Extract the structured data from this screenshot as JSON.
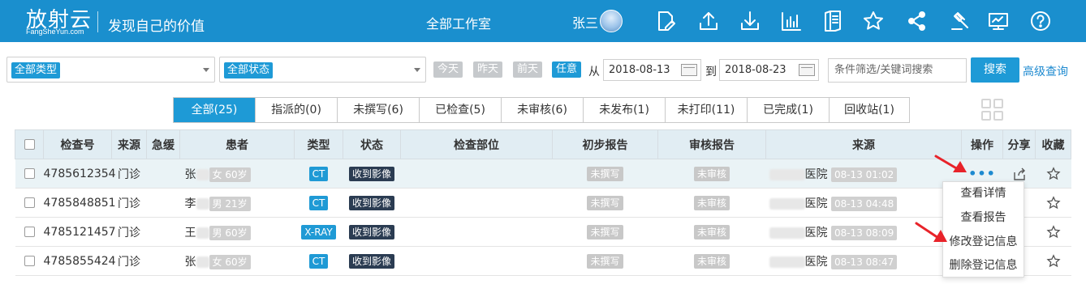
{
  "header": {
    "logo_main": "放射云",
    "logo_sub": "FangSheYun.com",
    "slogan": "发现自己的价值",
    "workspace": "全部工作室",
    "username": "张三"
  },
  "toolbar_icons": [
    "edit-icon",
    "upload-icon",
    "download-icon",
    "bar-chart-icon",
    "document-icon",
    "star-icon",
    "share-icon",
    "gavel-icon",
    "monitor-icon",
    "help-icon"
  ],
  "filters": {
    "type_select": "全部类型",
    "status_select": "全部状态",
    "quick_dates": [
      "今天",
      "昨天",
      "前天",
      "任意"
    ],
    "from_label": "从",
    "from_date": "2018-08-13",
    "to_label": "到",
    "to_date": "2018-08-23",
    "search_placeholder": "条件筛选/关键词搜索",
    "search_button": "搜索",
    "advanced": "高级查询"
  },
  "tabs": [
    {
      "label": "全部(25)"
    },
    {
      "label": "指派的(0)"
    },
    {
      "label": "未撰写(6)"
    },
    {
      "label": "已检查(5)"
    },
    {
      "label": "未审核(6)"
    },
    {
      "label": "未发布(1)"
    },
    {
      "label": "未打印(11)"
    },
    {
      "label": "已完成(1)"
    },
    {
      "label": "回收站(1)"
    }
  ],
  "columns": [
    "检查号",
    "来源",
    "急缓",
    "患者",
    "类型",
    "状态",
    "检查部位",
    "初步报告",
    "审核报告",
    "来源",
    "操作",
    "分享",
    "收藏"
  ],
  "rows": [
    {
      "id": "4785612354",
      "source": "门诊",
      "surname": "张",
      "patient_info": "女 60岁",
      "type": "CT",
      "status": "收到影像",
      "prelim": "未撰写",
      "review": "未审核",
      "hospital": "医院",
      "time": "08-13 01:02"
    },
    {
      "id": "4785848851",
      "source": "门诊",
      "surname": "李",
      "patient_info": "男 21岁",
      "type": "CT",
      "status": "收到影像",
      "prelim": "未撰写",
      "review": "未审核",
      "hospital": "医院",
      "time": "08-13 04:48"
    },
    {
      "id": "4785121457",
      "source": "门诊",
      "surname": "王",
      "patient_info": "男 60岁",
      "type": "X-RAY",
      "status": "收到影像",
      "prelim": "未撰写",
      "review": "未审核",
      "hospital": "医院",
      "time": "08-13 08:09"
    },
    {
      "id": "4785855424",
      "source": "门诊",
      "surname": "张",
      "patient_info": "女 60岁",
      "type": "CT",
      "status": "收到影像",
      "prelim": "未撰写",
      "review": "未审核",
      "hospital": "医院",
      "time": "08-13 08:47"
    }
  ],
  "dropdown": [
    "查看详情",
    "查看报告",
    "修改登记信息",
    "删除登记信息"
  ],
  "colors": {
    "brand": "#1a8fce",
    "accent": "#1e9ad6",
    "status_dark": "#2b3c52",
    "arrow": "#e8232a"
  }
}
